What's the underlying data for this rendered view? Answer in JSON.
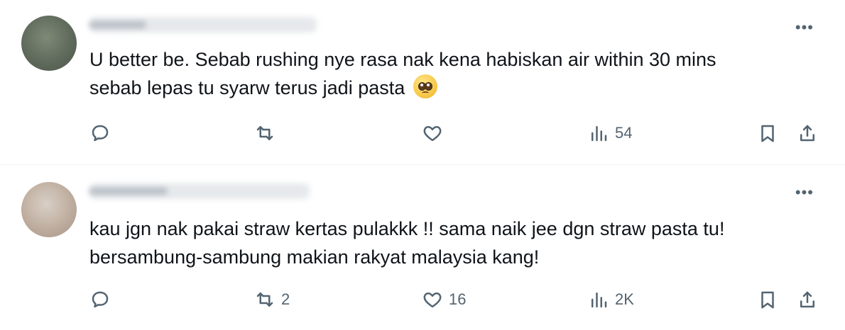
{
  "tweets": [
    {
      "text": "U better be. Sebab rushing nye rasa nak kena habiskan air within 30 mins\nsebab lepas tu syarw terus jadi pasta",
      "emoji_icon": "pleading-face-emoji",
      "stats": {
        "reply": "",
        "retweet": "",
        "like": "",
        "views": "54"
      }
    },
    {
      "text": "kau jgn nak pakai straw kertas pulakkk !! sama naik jee dgn straw pasta tu!\nbersambung-sambung makian rakyat malaysia kang!",
      "stats": {
        "reply": "",
        "retweet": "2",
        "like": "16",
        "views": "2K"
      }
    }
  ],
  "icons": {
    "more": "more-horizontal-icon",
    "reply": "reply-icon",
    "retweet": "retweet-icon",
    "like": "heart-icon",
    "views": "views-chart-icon",
    "bookmark": "bookmark-icon",
    "share": "share-icon"
  },
  "colors": {
    "icon": "#536471",
    "text": "#0f1419",
    "divider": "#eff3f4"
  }
}
